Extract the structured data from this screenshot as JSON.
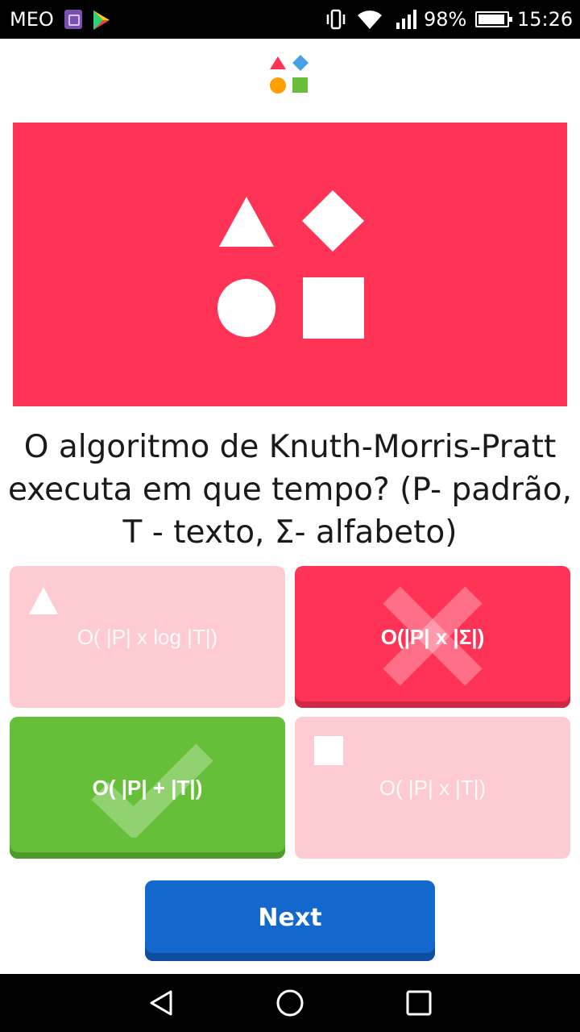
{
  "status_bar": {
    "carrier": "MEO",
    "battery": "98%",
    "time": "15:26"
  },
  "logo": {
    "icon": "kahoot-shapes-logo"
  },
  "hero": {
    "icon": "shapes-icon",
    "color": "#ff3355"
  },
  "question": {
    "text": "O algoritmo de Knuth-Morris-Pratt executa em que tempo? (P- padrão, T - texto, Σ- alfabeto)"
  },
  "answers": [
    {
      "label": "O( |P| x log |T|)",
      "shape": "triangle-icon",
      "state": "unselected",
      "color": "#ffcbd3"
    },
    {
      "label": "O(|P| x |Σ|)",
      "shape": "diamond-icon",
      "state": "wrong",
      "color": "#ff3355"
    },
    {
      "label": "O( |P| + |T|)",
      "shape": "circle-icon",
      "state": "correct",
      "color": "#66bf39"
    },
    {
      "label": "O( |P| x |T|)",
      "shape": "square-icon",
      "state": "unselected",
      "color": "#ffcbd3"
    }
  ],
  "next_button": {
    "label": "Next",
    "color": "#1368ce"
  }
}
